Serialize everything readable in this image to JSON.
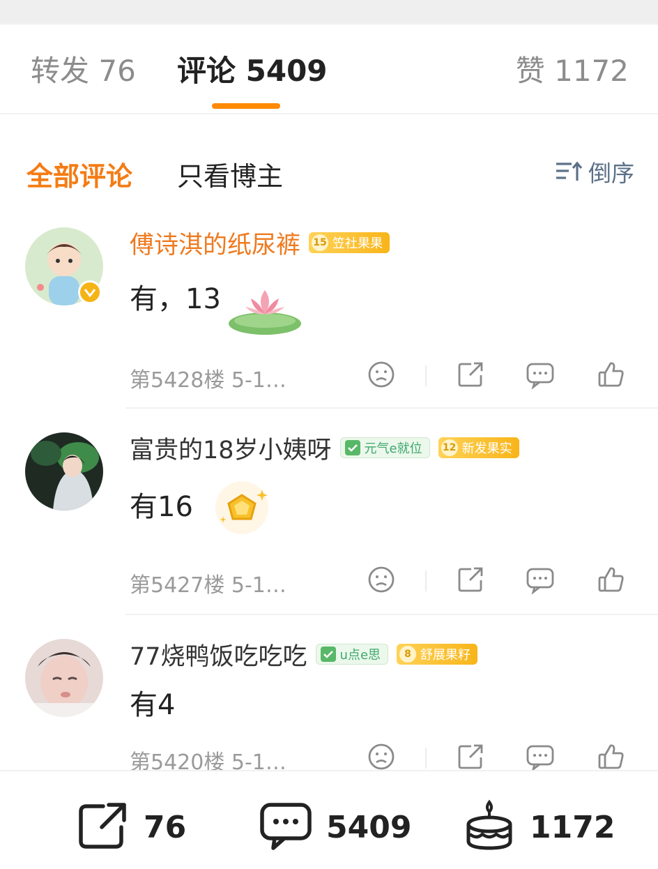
{
  "tabs": {
    "repost": "转发 76",
    "comments": "评论 5409",
    "likes": "赞 1172"
  },
  "filter": {
    "all": "全部评论",
    "owner_only": "只看博主",
    "sort": "倒序"
  },
  "comments": [
    {
      "username": "傅诗淇的纸尿裤",
      "level_badge": {
        "level": "15",
        "label": "笠社果果"
      },
      "text": "有，13",
      "floor": "第5428楼 5-1…",
      "verified": true
    },
    {
      "username": "富贵的18岁小姨呀",
      "fan_badge": "元气e就位",
      "level_badge": {
        "level": "12",
        "label": "新发果实"
      },
      "text": "有16",
      "floor": "第5427楼 5-1…"
    },
    {
      "username": "77烧鸭饭吃吃吃",
      "fan_badge": "u点e思",
      "level_badge": {
        "level": "8",
        "label": "舒展果籽"
      },
      "text": "有4",
      "floor": "第5420楼 5-1…"
    }
  ],
  "bottom_bar": {
    "repost_count": "76",
    "comment_count": "5409",
    "like_count": "1172"
  },
  "colors": {
    "accent": "#ff8a00",
    "orange_name": "#ef7a1f",
    "sort_blue": "#5c7188"
  }
}
